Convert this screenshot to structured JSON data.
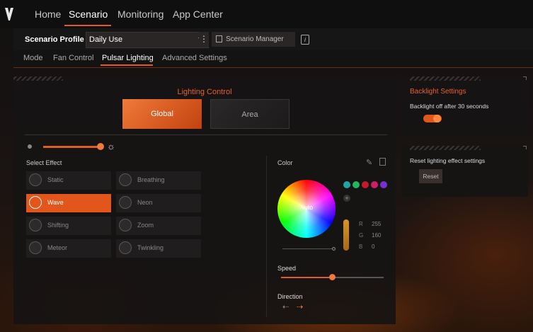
{
  "nav": {
    "tabs": [
      "Home",
      "Scenario",
      "Monitoring",
      "App Center"
    ],
    "active": "Scenario"
  },
  "profile": {
    "label": "Scenario Profile",
    "selected": "Daily Use",
    "manager_label": "Scenario Manager"
  },
  "subtabs": {
    "items": [
      "Mode",
      "Fan Control",
      "Pulsar Lighting",
      "Advanced Settings"
    ],
    "active": "Pulsar Lighting"
  },
  "lighting": {
    "title": "Lighting Control",
    "global_label": "Global",
    "area_label": "Area",
    "selected_zone": "Global",
    "brightness_percent": 100
  },
  "effects": {
    "label": "Select Effect",
    "items": [
      "Static",
      "Breathing",
      "Wave",
      "Neon",
      "Shifting",
      "Zoom",
      "Meteor",
      "Twinkling"
    ],
    "selected": "Wave"
  },
  "color": {
    "label": "Color",
    "wheel_label": "Auto",
    "swatches": [
      "#1fa6a0",
      "#20b85a",
      "#c61a2a",
      "#cc1f6a",
      "#7a2fd0"
    ],
    "r_label": "R",
    "g_label": "G",
    "b_label": "B",
    "r": "255",
    "g": "160",
    "b": "0"
  },
  "speed": {
    "label": "Speed",
    "value_percent": 50
  },
  "direction": {
    "label": "Direction",
    "selected": "right"
  },
  "backlight": {
    "title": "Backlight Settings",
    "text": "Backlight off after 30 seconds",
    "enabled": true
  },
  "reset": {
    "text": "Reset lighting effect settings",
    "button_label": "Reset"
  },
  "colors": {
    "accent": "#e25c1d",
    "accent_text": "#e8622a"
  }
}
